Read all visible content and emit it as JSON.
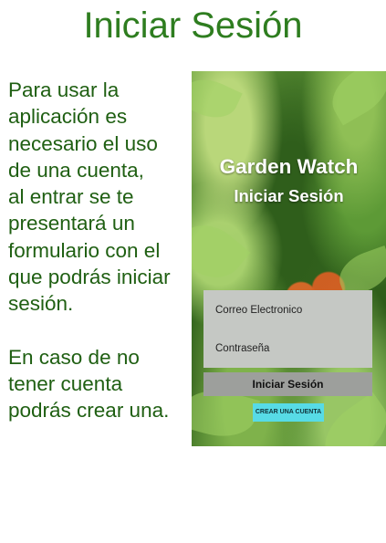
{
  "page": {
    "title": "Iniciar Sesión",
    "paragraphs": [
      "Para usar la\naplicación es\nnecesario el uso\nde una cuenta,\nal entrar se te\npresentará un\nformulario con el\nque podrás iniciar\nsesión.",
      "En caso de no\ntener cuenta\npodrás crear una."
    ]
  },
  "phone": {
    "app_name": "Garden Watch",
    "screen_title": "Iniciar Sesión",
    "email_placeholder": "Correo Electronico",
    "password_placeholder": "Contraseña",
    "login_button": "Iniciar Sesión",
    "create_account_button": "CREAR UNA CUENTA"
  },
  "colors": {
    "title_green": "#2e7d1f",
    "text_green": "#1f5f12",
    "form_gray": "#c5c8c4",
    "button_gray": "#9d9f9c",
    "accent_cyan": "#57dbe6"
  }
}
